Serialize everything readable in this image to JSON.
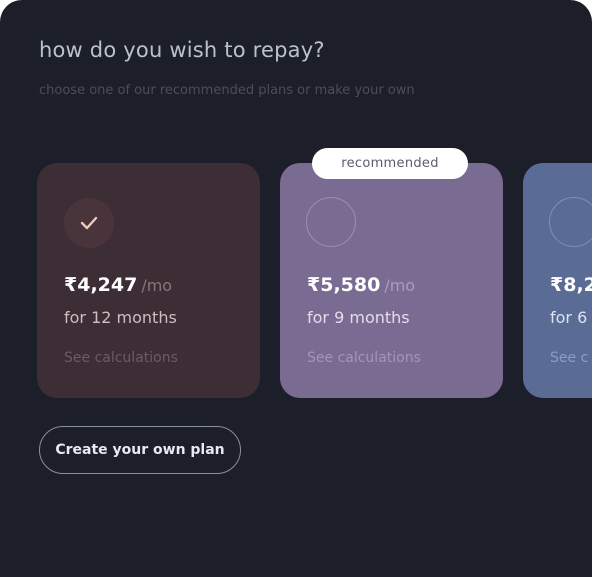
{
  "header": {
    "title": "how do you wish to repay?",
    "subtitle": "choose one of our recommended plans or make your own"
  },
  "recommended_badge": "recommended",
  "plans": [
    {
      "amount": "₹4,247",
      "per": "/mo",
      "duration": "for 12 months",
      "see_calculations": "See calculations",
      "selected": true,
      "color": "#3d2d35"
    },
    {
      "amount": "₹5,580",
      "per": "/mo",
      "duration": "for 9 months",
      "see_calculations": "See calculations",
      "selected": false,
      "recommended": true,
      "color": "#7a6b93"
    },
    {
      "amount": "₹8,2",
      "duration": "for 6",
      "see_calculations": "See c",
      "selected": false,
      "color": "#5a6b95"
    }
  ],
  "create_plan_button": "Create your own plan",
  "colors": {
    "background": "#1c1e29",
    "title": "#b9c3ce"
  }
}
